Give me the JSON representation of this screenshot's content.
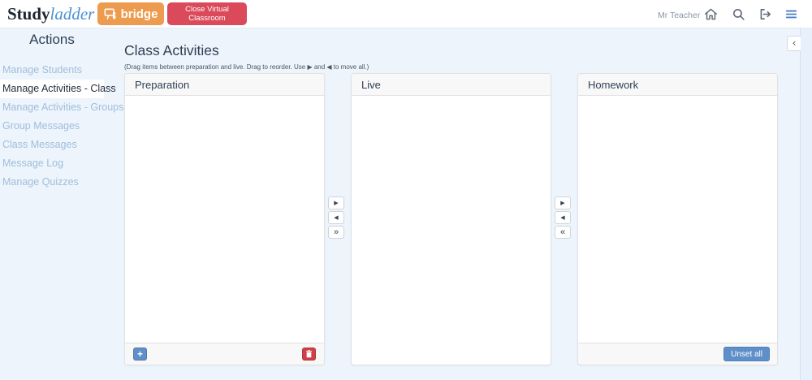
{
  "topbar": {
    "logo_part1": "Study",
    "logo_part2": "ladder",
    "bridge_label": "bridge",
    "close_label": "Close Virtual Classroom",
    "user_name": "Mr Teacher"
  },
  "sidebar": {
    "title": "Actions",
    "items": [
      {
        "label": "Manage Students",
        "selected": false
      },
      {
        "label": "Manage Activities - Class",
        "selected": true
      },
      {
        "label": "Manage Activities - Groups",
        "selected": false
      },
      {
        "label": "Group Messages",
        "selected": false
      },
      {
        "label": "Class Messages",
        "selected": false
      },
      {
        "label": "Message Log",
        "selected": false
      },
      {
        "label": "Manage Quizzes",
        "selected": false
      }
    ]
  },
  "main": {
    "title": "Class Activities",
    "subtitle": "(Drag items between preparation and live. Drag to reorder. Use ▶ and ◀ to move all.)",
    "panels": {
      "preparation": {
        "title": "Preparation",
        "add_label": "+"
      },
      "live": {
        "title": "Live"
      },
      "homework": {
        "title": "Homework",
        "unset_all_label": "Unset all"
      }
    },
    "movers": {
      "prep_live": {
        "move_right": "▶",
        "move_left": "◀",
        "move_all": "»"
      },
      "live_homework": {
        "move_right": "▶",
        "move_left": "◀",
        "move_all": "«"
      }
    }
  },
  "right_panel": {
    "collapse_glyph": "‹"
  },
  "colors": {
    "page_bg": "#EDF4FC",
    "bridge_orange": "#ED9B4E",
    "close_red": "#DB4A5B",
    "accent_blue": "#5F8FC9",
    "danger_red": "#CF4049",
    "menu_blue": "#4D7FC4",
    "sidebar_link": "#9FBEDD",
    "heading_navy": "#2E3F54",
    "logo_blue": "#4A90D2"
  }
}
